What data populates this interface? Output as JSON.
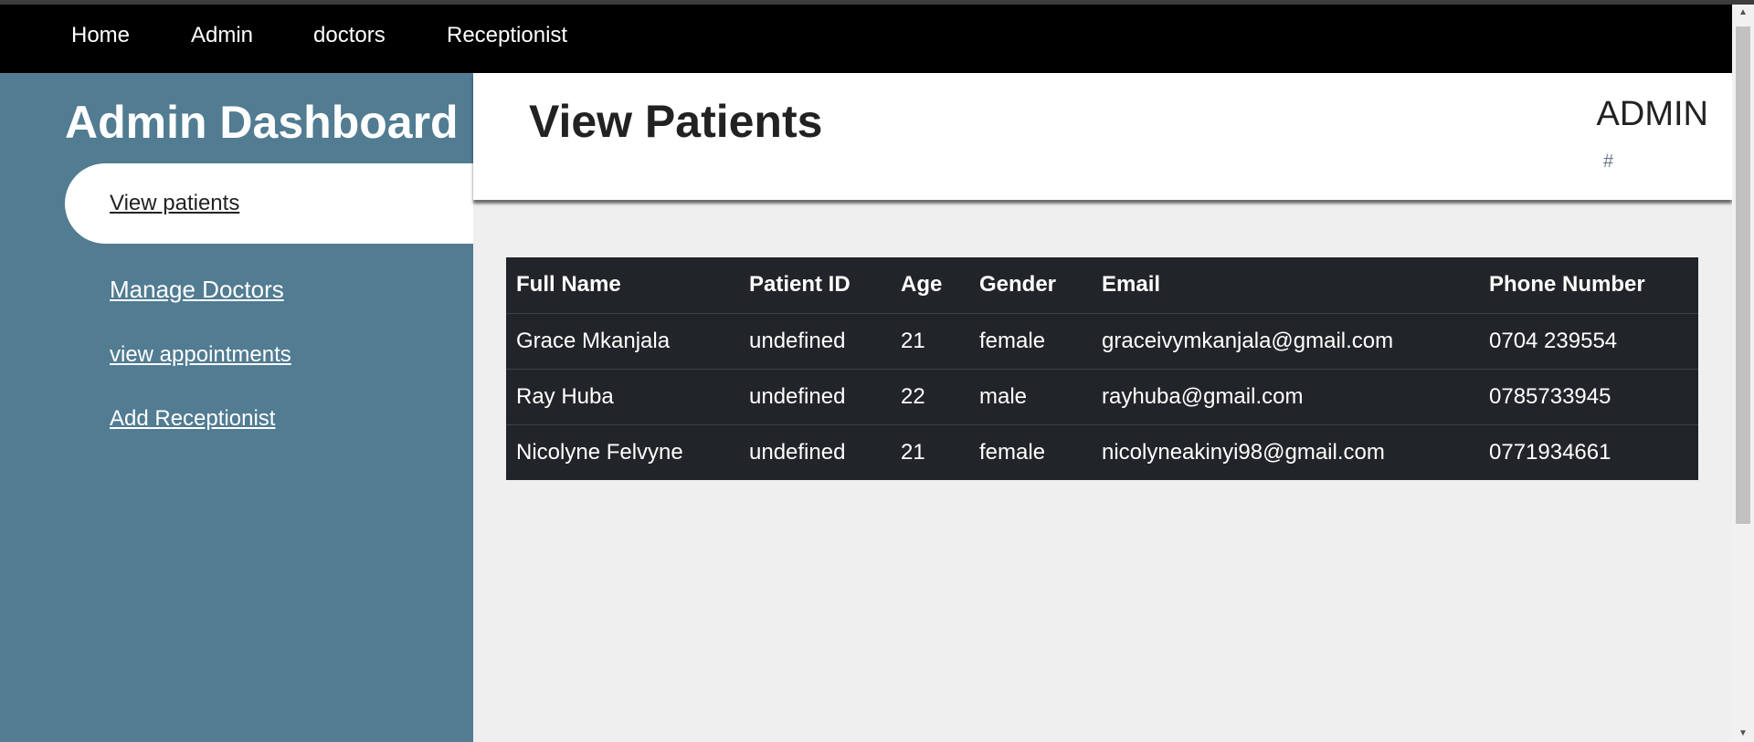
{
  "nav": {
    "items": [
      {
        "label": "Home"
      },
      {
        "label": "Admin"
      },
      {
        "label": "doctors"
      },
      {
        "label": "Receptionist"
      }
    ]
  },
  "sidebar": {
    "title": "Admin Dashboard",
    "items": [
      {
        "label": "View patients",
        "active": true
      },
      {
        "label": "Manage Doctors"
      },
      {
        "label": "view appointments"
      },
      {
        "label": "Add Receptionist"
      }
    ]
  },
  "header": {
    "title": "View Patients",
    "user_label": "ADMIN",
    "link": "#"
  },
  "table": {
    "columns": [
      "Full Name",
      "Patient ID",
      "Age",
      "Gender",
      "Email",
      "Phone Number"
    ],
    "rows": [
      [
        "Grace Mkanjala",
        "undefined",
        "21",
        "female",
        "graceivymkanjala@gmail.com",
        "0704 239554"
      ],
      [
        "Ray Huba",
        "undefined",
        "22",
        "male",
        "rayhuba@gmail.com",
        "0785733945"
      ],
      [
        "Nicolyne Felvyne",
        "undefined",
        "21",
        "female",
        "nicolyneakinyi98@gmail.com",
        "0771934661"
      ]
    ]
  },
  "colors": {
    "navbar": "#000000",
    "sidebar": "#517c92",
    "table": "#212529",
    "content_bg": "#efefef"
  },
  "icons": {
    "scroll_up": "scroll-up-arrow-icon",
    "scroll_down": "scroll-down-arrow-icon"
  }
}
